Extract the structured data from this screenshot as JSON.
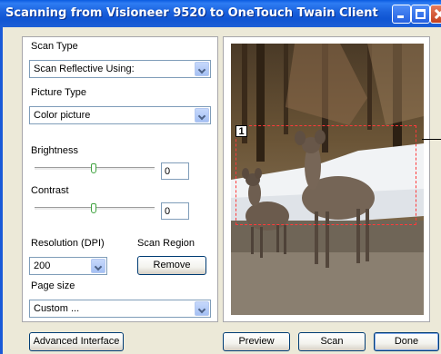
{
  "window": {
    "title": "Scanning from Visioneer 9520 to OneTouch Twain Client"
  },
  "settings": {
    "scan_type_label": "Scan Type",
    "scan_type_value": "Scan Reflective Using:",
    "picture_type_label": "Picture Type",
    "picture_type_value": "Color picture",
    "brightness_label": "Brightness",
    "brightness_value": "0",
    "contrast_label": "Contrast",
    "contrast_value": "0",
    "resolution_label": "Resolution (DPI)",
    "resolution_value": "200",
    "scan_region_label": "Scan Region",
    "remove_button": "Remove",
    "page_size_label": "Page size",
    "page_size_value": "Custom ..."
  },
  "buttons": {
    "advanced": "Advanced Interface",
    "preview": "Preview",
    "scan": "Scan",
    "done": "Done"
  },
  "preview": {
    "region_number": "1"
  },
  "colors": {
    "titlebar": "#1a61dc",
    "region_border": "#ff3a3a",
    "slider_thumb": "#3fa33f"
  }
}
